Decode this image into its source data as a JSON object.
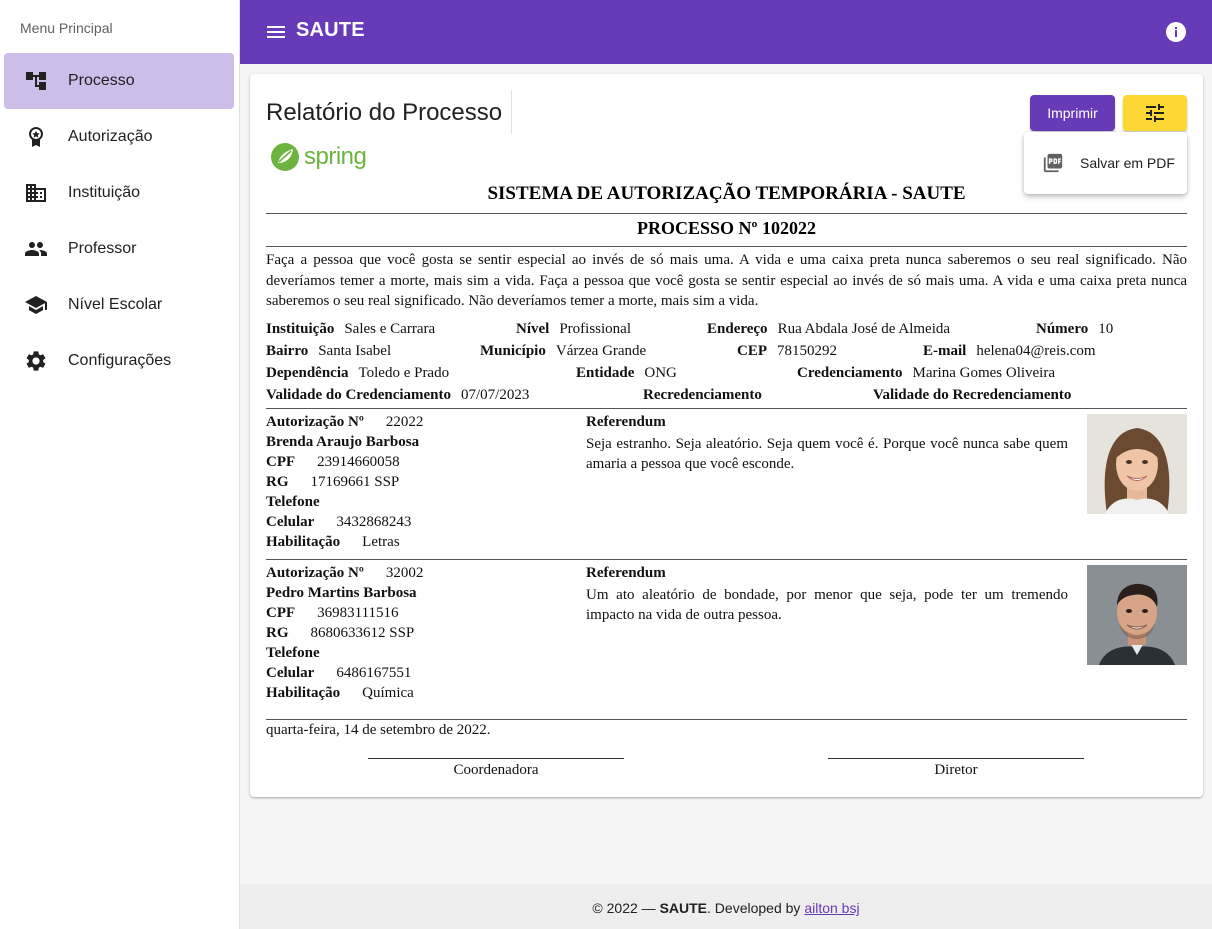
{
  "app": {
    "title": "SAUTE"
  },
  "sidebar": {
    "heading": "Menu Principal",
    "items": [
      {
        "label": "Processo",
        "icon": "account-tree-icon",
        "active": true
      },
      {
        "label": "Autorização",
        "icon": "badge-award-icon"
      },
      {
        "label": "Instituição",
        "icon": "building-icon"
      },
      {
        "label": "Professor",
        "icon": "people-icon"
      },
      {
        "label": "Nível Escolar",
        "icon": "school-cap-icon"
      },
      {
        "label": "Configurações",
        "icon": "gear-icon"
      }
    ]
  },
  "header": {
    "menu_icon": "hamburger-icon",
    "info_icon": "info-icon"
  },
  "report": {
    "page_title": "Relatório do Processo",
    "print_label": "Imprimir",
    "settings_icon": "tune-icon",
    "dropdown": {
      "save_pdf_label": "Salvar em PDF",
      "icon": "pdf-icon"
    },
    "logo_text": "spring",
    "system_title": "SISTEMA DE AUTORIZAÇÃO TEMPORÁRIA - SAUTE",
    "process_title": "PROCESSO Nº 102022",
    "intro": "Faça a pessoa que você gosta se sentir especial ao invés de só mais uma. A vida e uma caixa preta nunca saberemos o seu real significado. Não deveríamos temer a morte, mais sim a vida. Faça a pessoa que você gosta se sentir especial ao invés de só mais uma. A vida e uma caixa preta nunca saberemos o seu real significado. Não deveríamos temer a morte, mais sim a vida.",
    "institution": {
      "instituicao_label": "Instituição",
      "instituicao": "Sales e Carrara",
      "nivel_label": "Nível",
      "nivel": "Profissional",
      "endereco_label": "Endereço",
      "endereco": "Rua Abdala José de Almeida",
      "numero_label": "Número",
      "numero": "10",
      "bairro_label": "Bairro",
      "bairro": "Santa Isabel",
      "municipio_label": "Município",
      "municipio": "Várzea Grande",
      "cep_label": "CEP",
      "cep": "78150292",
      "email_label": "E-mail",
      "email": "helena04@reis.com",
      "dependencia_label": "Dependência",
      "dependencia": "Toledo e Prado",
      "entidade_label": "Entidade",
      "entidade": "ONG",
      "credenciamento_label": "Credenciamento",
      "credenciamento": "Marina Gomes Oliveira",
      "validade_cred_label": "Validade do Credenciamento",
      "validade_cred": "07/07/2023",
      "recred_label": "Recredenciamento",
      "validade_recred_label": "Validade do Recredenciamento"
    },
    "labels": {
      "autorizacao": "Autorização Nº",
      "cpf": "CPF",
      "rg": "RG",
      "telefone": "Telefone",
      "celular": "Celular",
      "habilitacao": "Habilitação",
      "referendum": "Referendum"
    },
    "authorizations": [
      {
        "numero": "22022",
        "nome": "Brenda Araujo Barbosa",
        "cpf": "23914660058",
        "rg": "17169661 SSP",
        "telefone": "",
        "celular": "3432868243",
        "habilitacao": "Letras",
        "referendum": "Seja estranho. Seja aleatório. Seja quem você é. Porque você nunca sabe quem amaria a pessoa que você esconde.",
        "photo": "woman-portrait"
      },
      {
        "numero": "32002",
        "nome": "Pedro Martins Barbosa",
        "cpf": "36983111516",
        "rg": "8680633612 SSP",
        "telefone": "",
        "celular": "6486167551",
        "habilitacao": "Química",
        "referendum": "Um ato aleatório de bondade, por menor que seja, pode ter um tremendo impacto na vida de outra pessoa.",
        "photo": "man-portrait"
      }
    ],
    "date": "quarta-feira, 14 de setembro de 2022.",
    "signatures": {
      "left": "Coordenadora",
      "right": "Diretor"
    }
  },
  "footer": {
    "prefix": "© 2022 — ",
    "brand": "SAUTE",
    "middle": ". Developed by ",
    "author_link": "ailton bsj"
  },
  "colors": {
    "primary": "#673ab7",
    "accent": "#fdd835",
    "active_nav": "#cdbde9",
    "spring_green": "#6db33f"
  }
}
